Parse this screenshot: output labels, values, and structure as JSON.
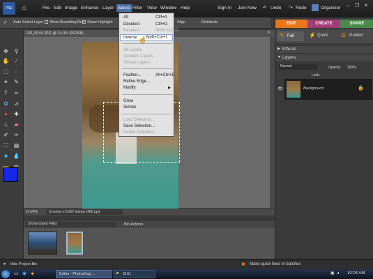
{
  "app": {
    "logo": "PSE"
  },
  "menubar": {
    "items": [
      "File",
      "Edit",
      "Image",
      "Enhance",
      "Layer",
      "Select",
      "Filter",
      "View",
      "Window",
      "Help"
    ],
    "sign_in": "Sign In",
    "join_now": "Join Now",
    "undo": "Undo",
    "redo": "Redo",
    "organizer": "Organizer"
  },
  "options": {
    "auto_select": "Auto Select Layer",
    "show_bounding": "Show Bounding Box",
    "show_highlight": "Show Highlight",
    "align": "Align",
    "distribute": "Distribute"
  },
  "document": {
    "tab": "103_0044.JPG @ 14.3% (RGB/8)",
    "zoom": "14.24%",
    "info": "3 inches x 6.667 inches (480 ppi)"
  },
  "select_menu": {
    "items": [
      {
        "label": "All",
        "shortcut": "Ctrl+A",
        "disabled": false
      },
      {
        "label": "Deselect",
        "shortcut": "Ctrl+D",
        "disabled": false
      },
      {
        "label": "Reselect",
        "shortcut": "Shift+Ctrl+D",
        "disabled": true
      },
      {
        "label": "Inverse",
        "shortcut": "Shift+Ctrl+I",
        "disabled": false
      },
      {
        "label": "All Layers",
        "shortcut": "",
        "disabled": true
      },
      {
        "label": "Deselect Layers",
        "shortcut": "",
        "disabled": true
      },
      {
        "label": "Similar Layers",
        "shortcut": "",
        "disabled": true
      },
      {
        "label": "Feather...",
        "shortcut": "Alt+Ctrl+D",
        "disabled": false
      },
      {
        "label": "Refine Edge...",
        "shortcut": "",
        "disabled": false
      },
      {
        "label": "Modify",
        "shortcut": "",
        "disabled": false
      },
      {
        "label": "Grow",
        "shortcut": "",
        "disabled": false
      },
      {
        "label": "Similar",
        "shortcut": "",
        "disabled": false
      },
      {
        "label": "Load Selection...",
        "shortcut": "",
        "disabled": true
      },
      {
        "label": "Save Selection...",
        "shortcut": "",
        "disabled": false
      },
      {
        "label": "Delete Selection...",
        "shortcut": "",
        "disabled": true
      }
    ]
  },
  "bin": {
    "show_files": "Show Open Files",
    "bin_actions": "Bin Actions",
    "hide": "Hide Project Bin"
  },
  "modes": {
    "edit": "EDIT",
    "create": "CREATE",
    "share": "SHARE",
    "full": "Full",
    "quick": "Quick",
    "guided": "Guided"
  },
  "panels": {
    "effects": "Effects",
    "layers": "Layers",
    "blend": "Normal",
    "opacity": "Opacity:",
    "opacity_val": "100%",
    "lock": "Lock:",
    "layer_name": "Background"
  },
  "taskbar": {
    "editor": "Editor - Photoshop ...",
    "folder": "0161",
    "time": "10:04 AM",
    "hint": "Make quick fixes in batches"
  },
  "colors": {
    "foreground": "#1428e8",
    "background": "#ffffff",
    "accent": "#4d6ea3"
  }
}
